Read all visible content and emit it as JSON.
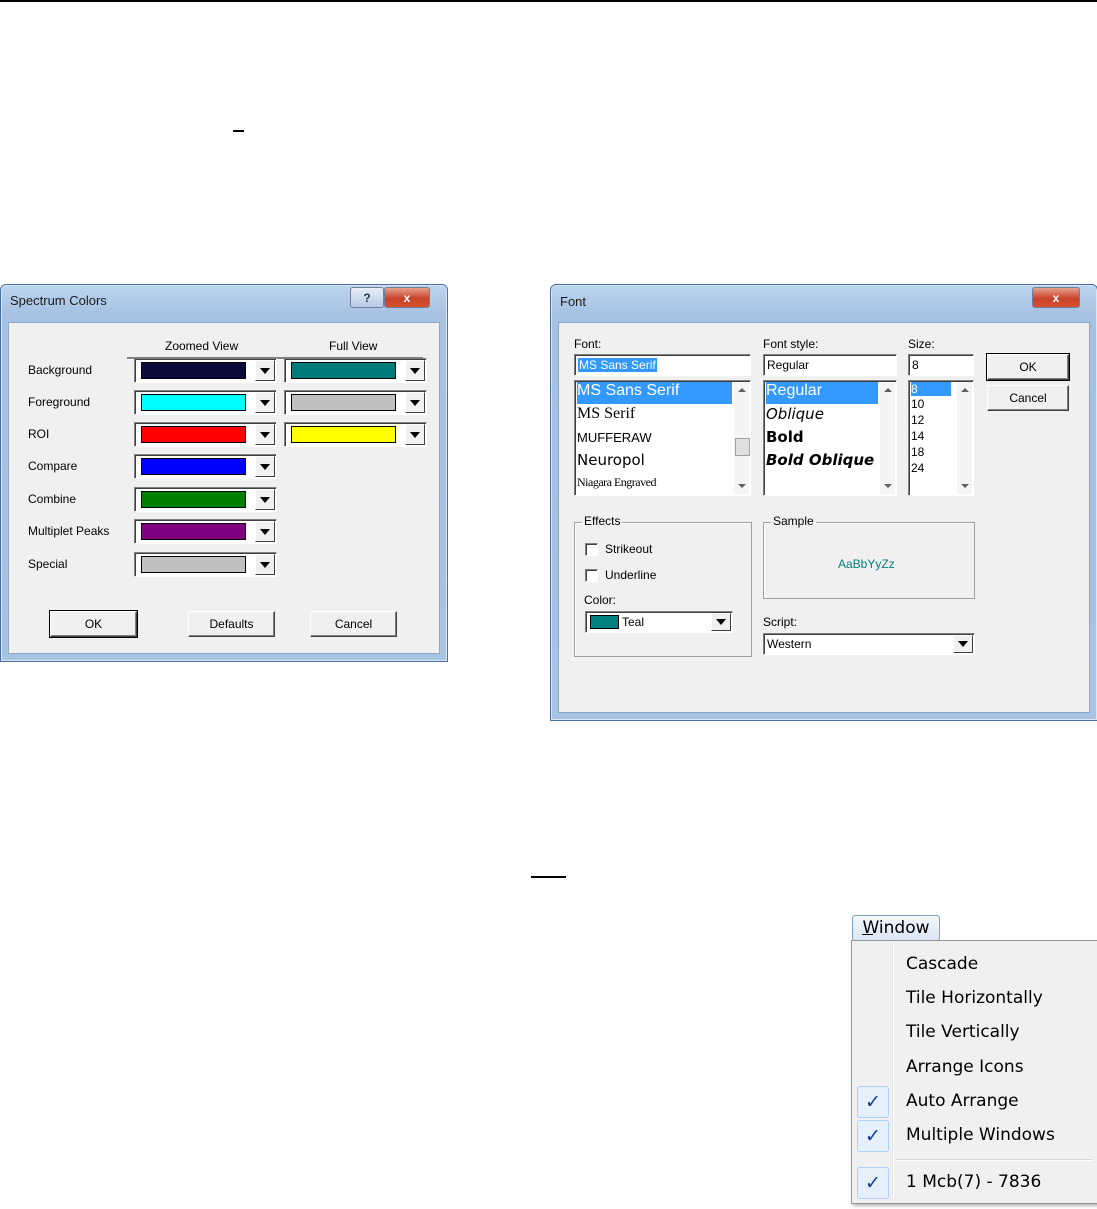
{
  "spectrum_dialog": {
    "title": "Spectrum Colors",
    "help_glyph": "?",
    "close_glyph": "x",
    "col_zoomed": "Zoomed View",
    "col_full": "Full View",
    "rows": [
      {
        "label": "Background",
        "zoomed": "#0b0b3b",
        "full": "#007b7b"
      },
      {
        "label": "Foreground",
        "zoomed": "#00ffff",
        "full": "#c0c0c0"
      },
      {
        "label": "ROI",
        "zoomed": "#ff0000",
        "full": "#ffff00"
      },
      {
        "label": "Compare",
        "zoomed": "#0000ff"
      },
      {
        "label": "Combine",
        "zoomed": "#008000"
      },
      {
        "label": "Multiplet Peaks",
        "zoomed": "#800080"
      },
      {
        "label": "Special",
        "zoomed": "#c0c0c0"
      }
    ],
    "ok": "OK",
    "defaults": "Defaults",
    "cancel": "Cancel"
  },
  "font_dialog": {
    "title": "Font",
    "close_glyph": "x",
    "font_label": "Font:",
    "font_value": "MS Sans Serif",
    "font_list": [
      "MS Sans Serif",
      "MS Serif",
      "MUFFERAW",
      "Neuropol",
      "Niagara Engraved"
    ],
    "style_label": "Font style:",
    "style_value": "Regular",
    "style_list": [
      "Regular",
      "Oblique",
      "Bold",
      "Bold Oblique"
    ],
    "size_label": "Size:",
    "size_value": "8",
    "size_list": [
      "8",
      "10",
      "12",
      "14",
      "18",
      "24"
    ],
    "ok": "OK",
    "cancel": "Cancel",
    "effects_label": "Effects",
    "strikeout": "Strikeout",
    "underline": "Underline",
    "color_label": "Color:",
    "color_value": "Teal",
    "color_hex": "#008080",
    "sample_label": "Sample",
    "sample_text": "AaBbYyZz",
    "script_label": "Script:",
    "script_value": "Western"
  },
  "window_menu": {
    "button": "Window",
    "items": [
      "Cascade",
      "Tile Horizontally",
      "Tile Vertically",
      "Arrange Icons",
      "Auto Arrange",
      "Multiple Windows",
      "1 Mcb(7) - 7836"
    ],
    "checked": [
      "Auto Arrange",
      "Multiple Windows",
      "1 Mcb(7) - 7836"
    ],
    "check_glyph": "✓"
  }
}
